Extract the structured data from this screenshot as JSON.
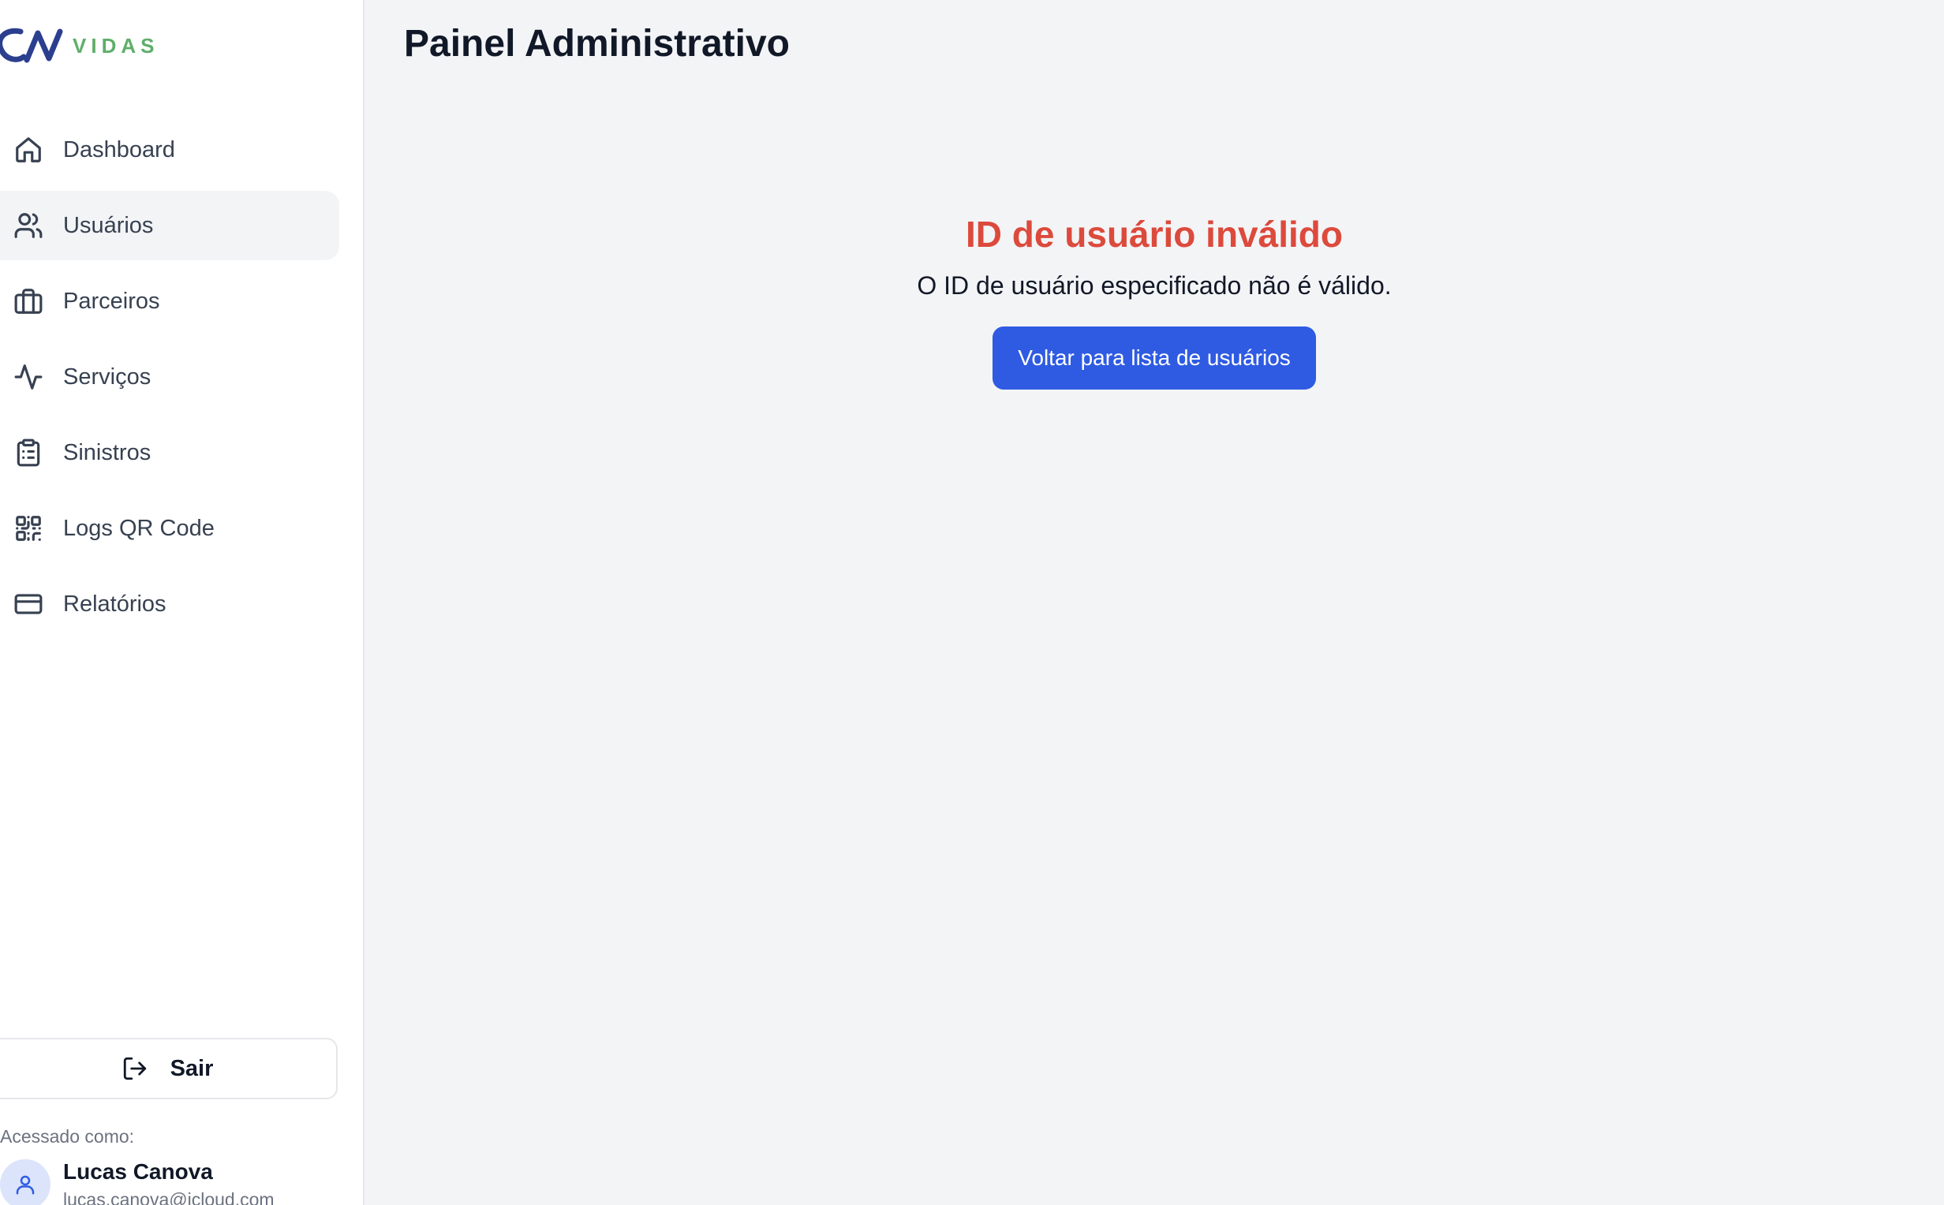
{
  "brand": {
    "logo_text": "VIDAS",
    "logo_mark_color": "#2c3f8f",
    "logo_text_color": "#5fae6a"
  },
  "sidebar": {
    "items": [
      {
        "label": "Dashboard",
        "icon": "home-icon",
        "active": false
      },
      {
        "label": "Usuários",
        "icon": "users-icon",
        "active": true
      },
      {
        "label": "Parceiros",
        "icon": "briefcase-icon",
        "active": false
      },
      {
        "label": "Serviços",
        "icon": "activity-icon",
        "active": false
      },
      {
        "label": "Sinistros",
        "icon": "clipboard-list-icon",
        "active": false
      },
      {
        "label": "Logs QR Code",
        "icon": "qr-code-icon",
        "active": false
      },
      {
        "label": "Relatórios",
        "icon": "credit-card-icon",
        "active": false
      }
    ],
    "logout_label": "Sair",
    "accessed_as_label": "Acessado como:",
    "user": {
      "name": "Lucas Canova",
      "email": "lucas.canova@icloud.com"
    }
  },
  "main": {
    "title": "Painel Administrativo",
    "error": {
      "title": "ID de usuário inválido",
      "message": "O ID de usuário especificado não é válido.",
      "button_label": "Voltar para lista de usuários"
    }
  },
  "colors": {
    "error_title": "#dc4a3c",
    "primary_button": "#2f5be3",
    "active_nav_bg": "#f3f4f6"
  }
}
